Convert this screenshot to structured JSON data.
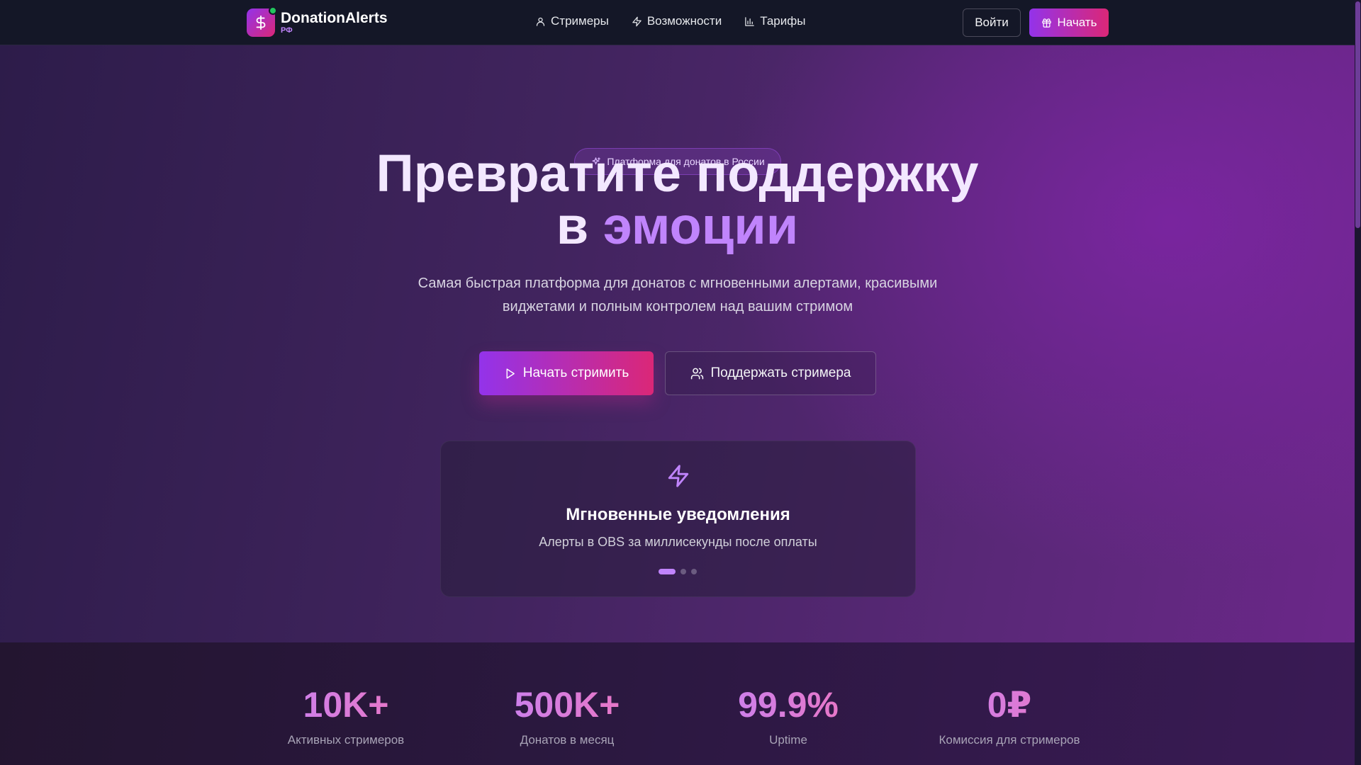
{
  "header": {
    "logo_name": "DonationAlerts",
    "logo_sub": "РФ",
    "nav": [
      {
        "label": "Стримеры",
        "icon": "user-icon"
      },
      {
        "label": "Возможности",
        "icon": "zap-icon"
      },
      {
        "label": "Тарифы",
        "icon": "bar-chart-icon"
      }
    ],
    "login_label": "Войти",
    "start_label": "Начать"
  },
  "hero": {
    "badge": "Платформа для донатов в России",
    "headline_line1": "Превратите поддержку",
    "headline_line2_prefix": "в ",
    "headline_line2_accent": "эмоции",
    "subtitle": "Самая быстрая платформа для донатов с мгновенными алертами, красивыми виджетами и полным контролем над вашим стримом",
    "primary_button": "Начать стримить",
    "secondary_button": "Поддержать стримера"
  },
  "feature": {
    "title": "Мгновенные уведомления",
    "description": "Алерты в OBS за миллисекунды после оплаты",
    "slides_total": 3,
    "active_slide": 1
  },
  "stats": [
    {
      "value": "10K+",
      "label": "Активных стримеров"
    },
    {
      "value": "500K+",
      "label": "Донатов в месяц"
    },
    {
      "value": "99.9%",
      "label": "Uptime"
    },
    {
      "value": "0₽",
      "label": "Комиссия для стримеров"
    }
  ],
  "colors": {
    "accent_purple": "#9333ea",
    "accent_pink": "#db2777",
    "accent_light": "#c084fc",
    "online_green": "#22c55e"
  }
}
